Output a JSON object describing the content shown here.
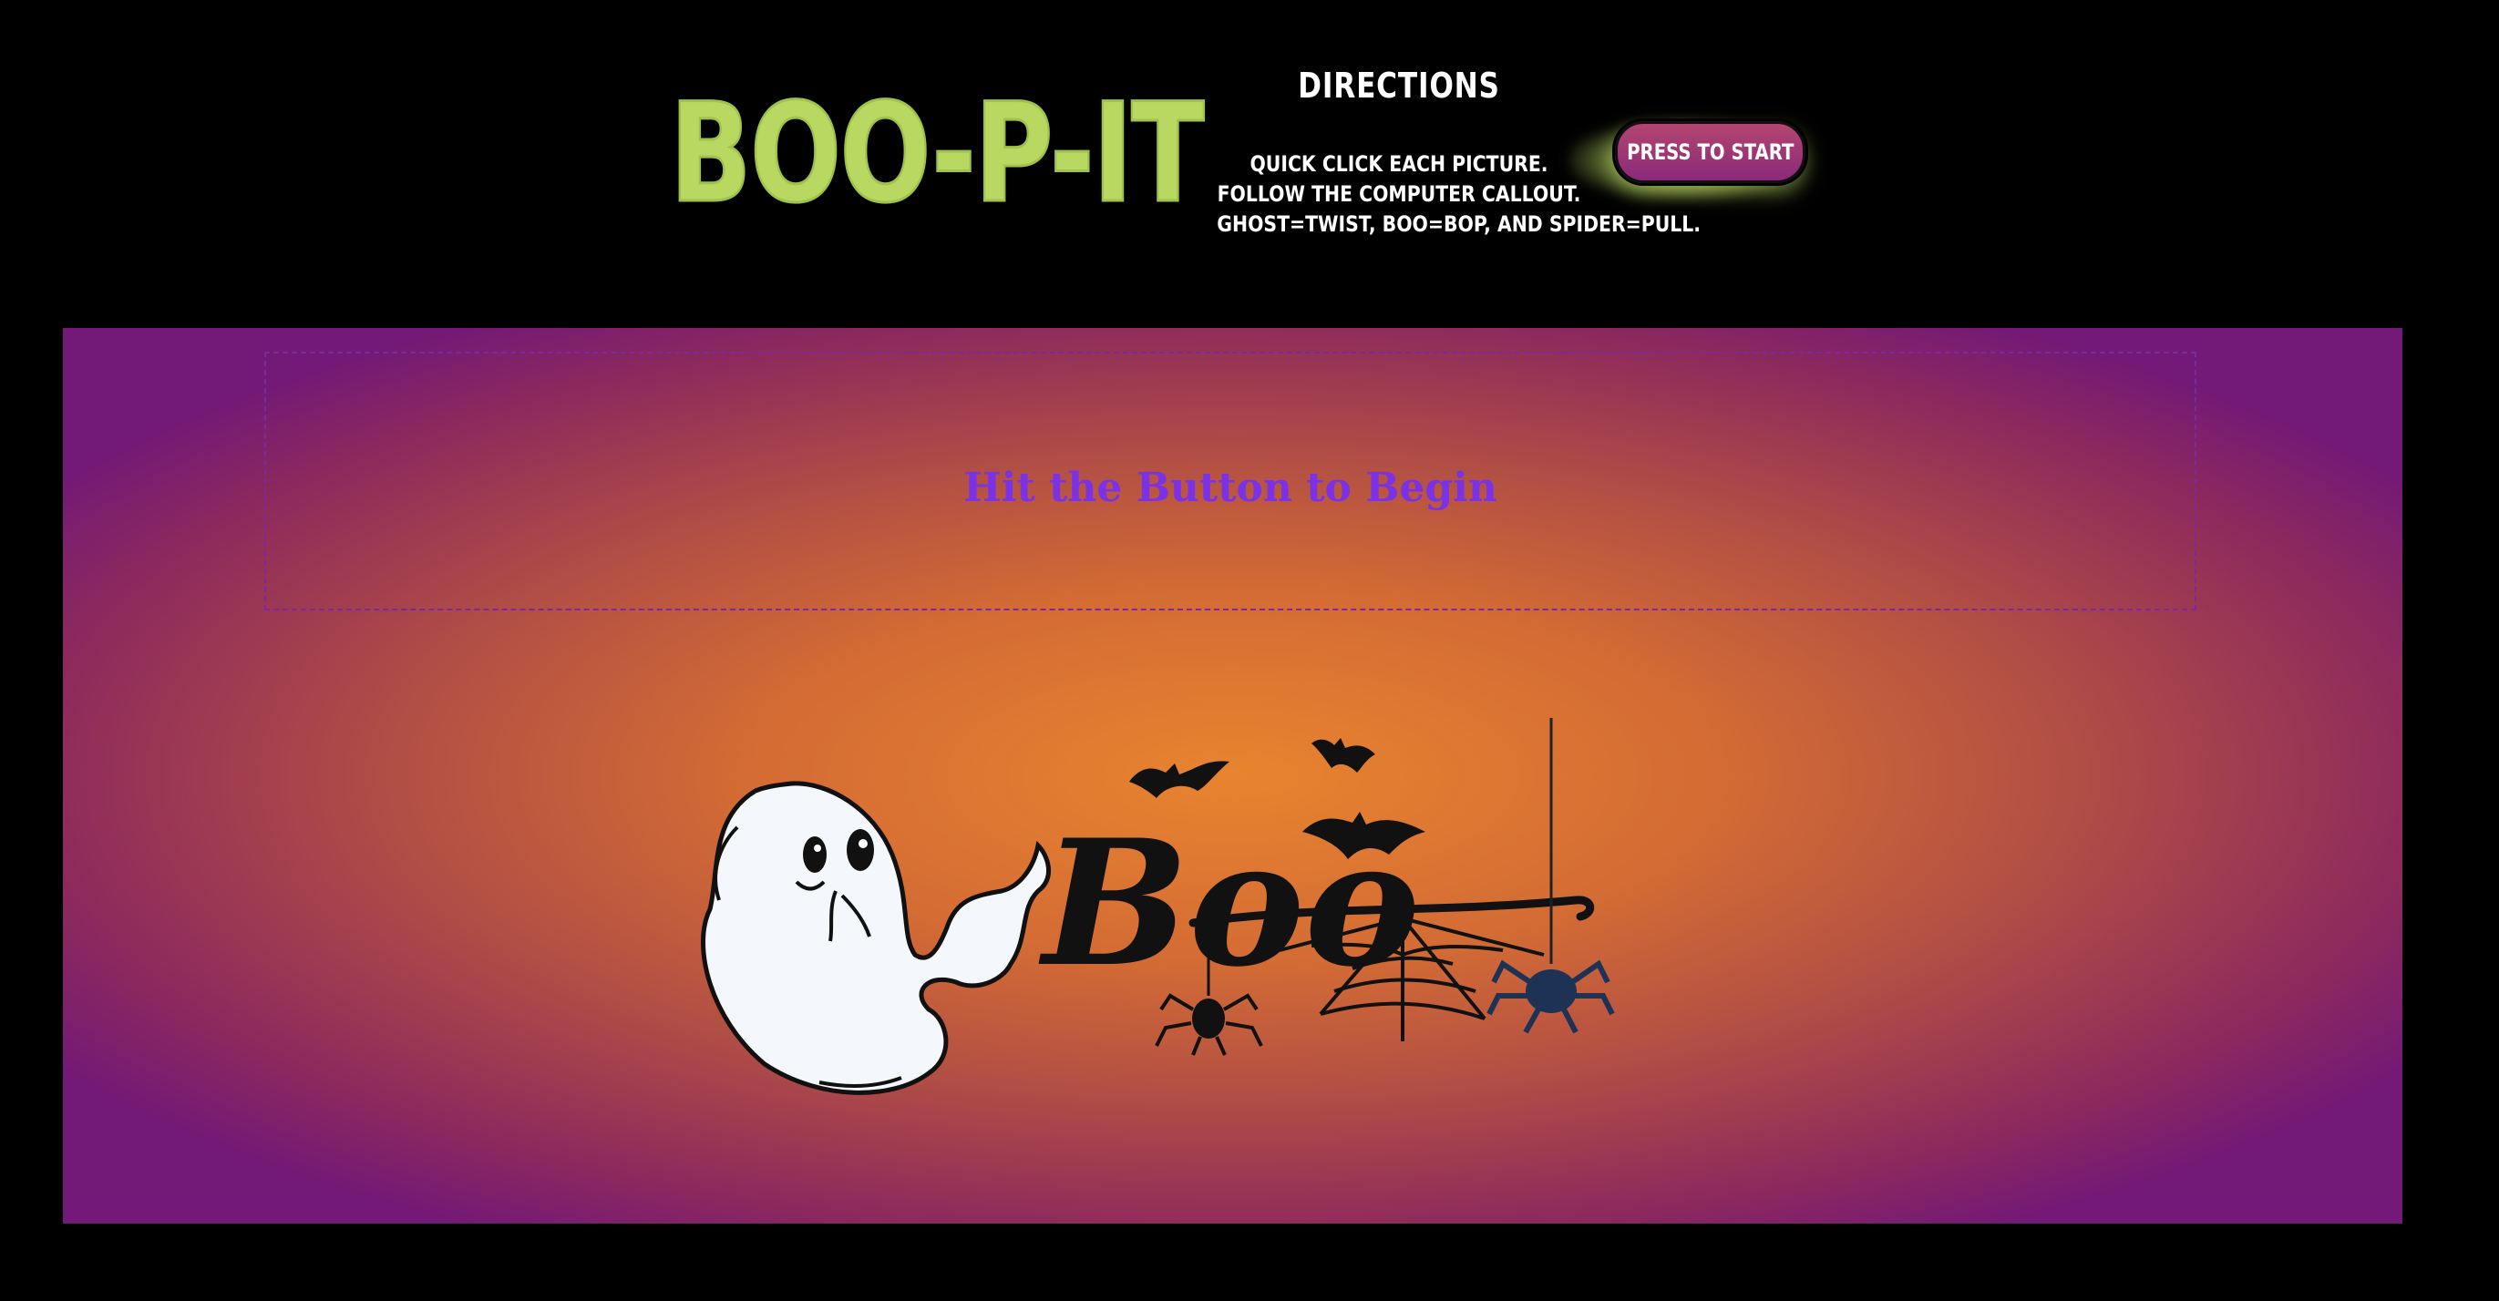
{
  "header": {
    "logo_text": "BOO-P-IT",
    "directions": {
      "title": "DIRECTIONS",
      "lines": [
        "QUICK CLICK EACH PICTURE.",
        "FOLLOW THE COMPUTER CALLOUT.",
        "GHOST=TWIST, BOO=BOP, AND SPIDER=PULL."
      ]
    },
    "start_button_label": "PRESS TO START"
  },
  "game": {
    "callout_text": "Hit the Button to Begin",
    "artwork_text": "Boo",
    "artwork_items": [
      "ghost",
      "bats",
      "spider-web",
      "spiders"
    ]
  },
  "colors": {
    "logo": "#b9d862",
    "callout_text": "#7b32e6",
    "background": "#000000",
    "game_center": "#e8842f",
    "game_edge": "#731977",
    "button": "#a63a73"
  },
  "icons": [
    "ghost-icon",
    "bat-icon",
    "spider-web-icon",
    "spider-icon"
  ]
}
